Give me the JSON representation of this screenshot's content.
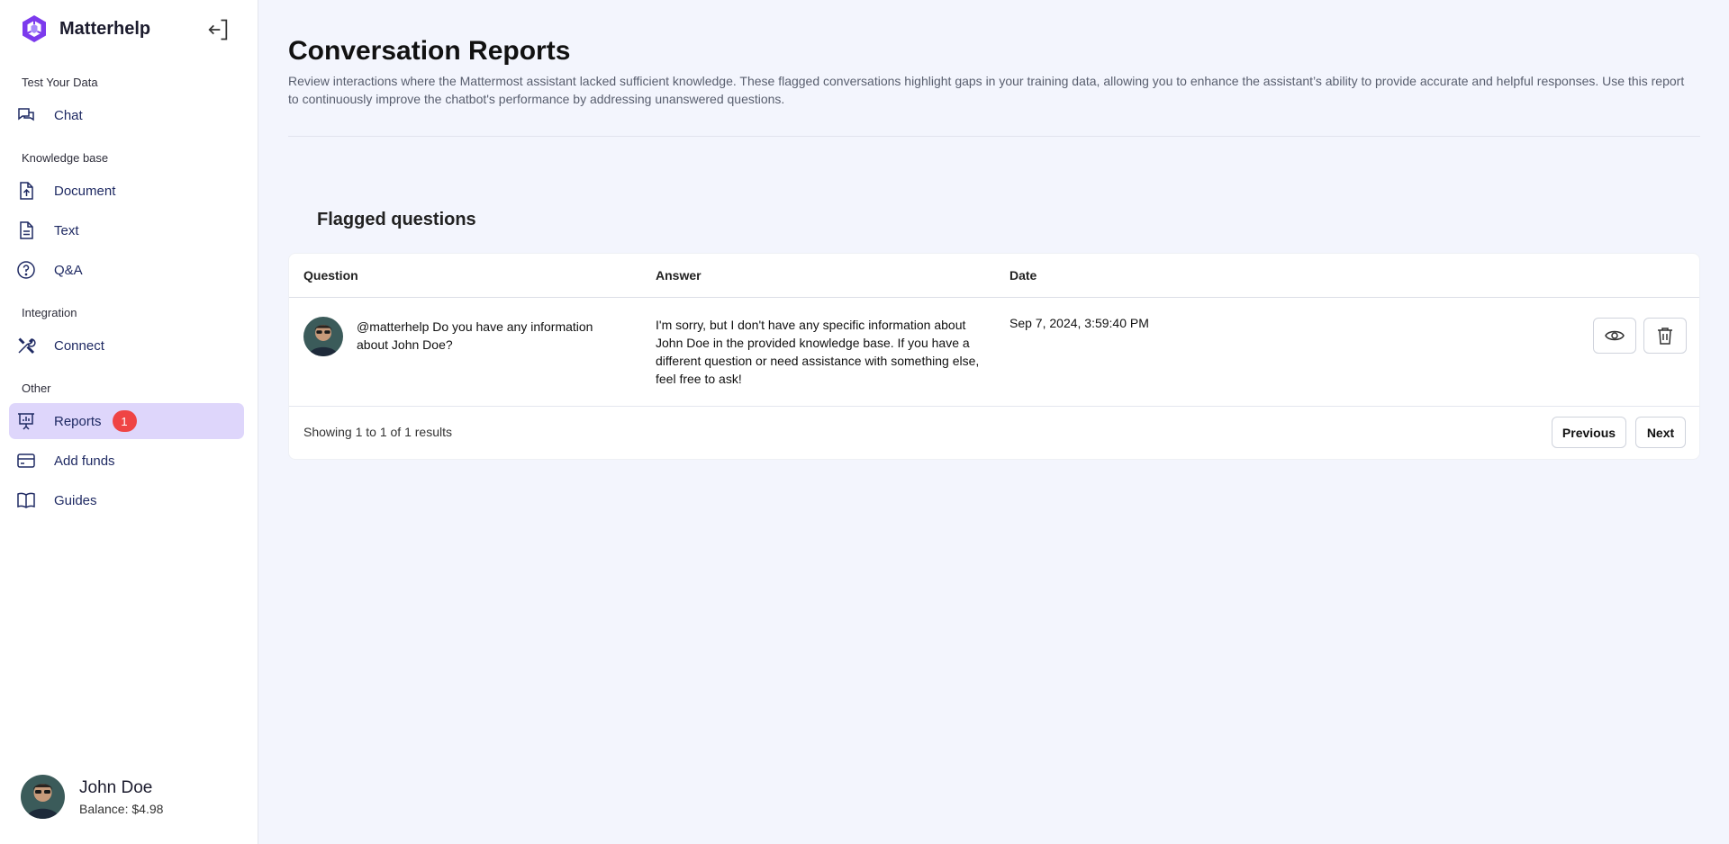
{
  "brand": {
    "name": "Matterhelp",
    "logo_icon": "hexagon-logo-icon"
  },
  "sidebar": {
    "sections": [
      {
        "title": "Test Your Data"
      },
      {
        "title": "Knowledge base"
      },
      {
        "title": "Integration"
      },
      {
        "title": "Other"
      }
    ],
    "items": [
      {
        "label": "Chat",
        "icon": "chat-bubbles-icon"
      },
      {
        "label": "Document",
        "icon": "file-upload-icon"
      },
      {
        "label": "Text",
        "icon": "file-text-icon"
      },
      {
        "label": "Q&A",
        "icon": "question-circle-icon"
      },
      {
        "label": "Connect",
        "icon": "tools-icon"
      },
      {
        "label": "Reports",
        "icon": "presentation-chart-icon",
        "badge": "1",
        "active": true
      },
      {
        "label": "Add funds",
        "icon": "credit-card-icon"
      },
      {
        "label": "Guides",
        "icon": "book-open-icon"
      }
    ]
  },
  "user": {
    "name": "John Doe",
    "balance": "Balance: $4.98"
  },
  "page": {
    "title": "Conversation Reports",
    "description": "Review interactions where the Mattermost assistant lacked sufficient knowledge. These flagged conversations highlight gaps in your training data, allowing you to enhance the assistant’s ability to provide accurate and helpful responses. Use this report to continuously improve the chatbot's performance by addressing unanswered questions."
  },
  "flagged": {
    "title": "Flagged questions",
    "columns": [
      "Question",
      "Answer",
      "Date"
    ],
    "rows": [
      {
        "question": "@matterhelp Do you have any information about John Doe?",
        "answer": "I'm sorry, but I don't have any specific information about John Doe in the provided knowledge base. If you have a different question or need assistance with something else, feel free to ask!",
        "date": "Sep 7, 2024, 3:59:40 PM"
      }
    ],
    "showing": "Showing 1 to 1 of 1 results",
    "prev_label": "Previous",
    "next_label": "Next"
  },
  "colors": {
    "accent": "#7c3aed",
    "active_bg": "#ded6fb",
    "badge": "#ef4444",
    "nav_text": "#1f2a63"
  }
}
